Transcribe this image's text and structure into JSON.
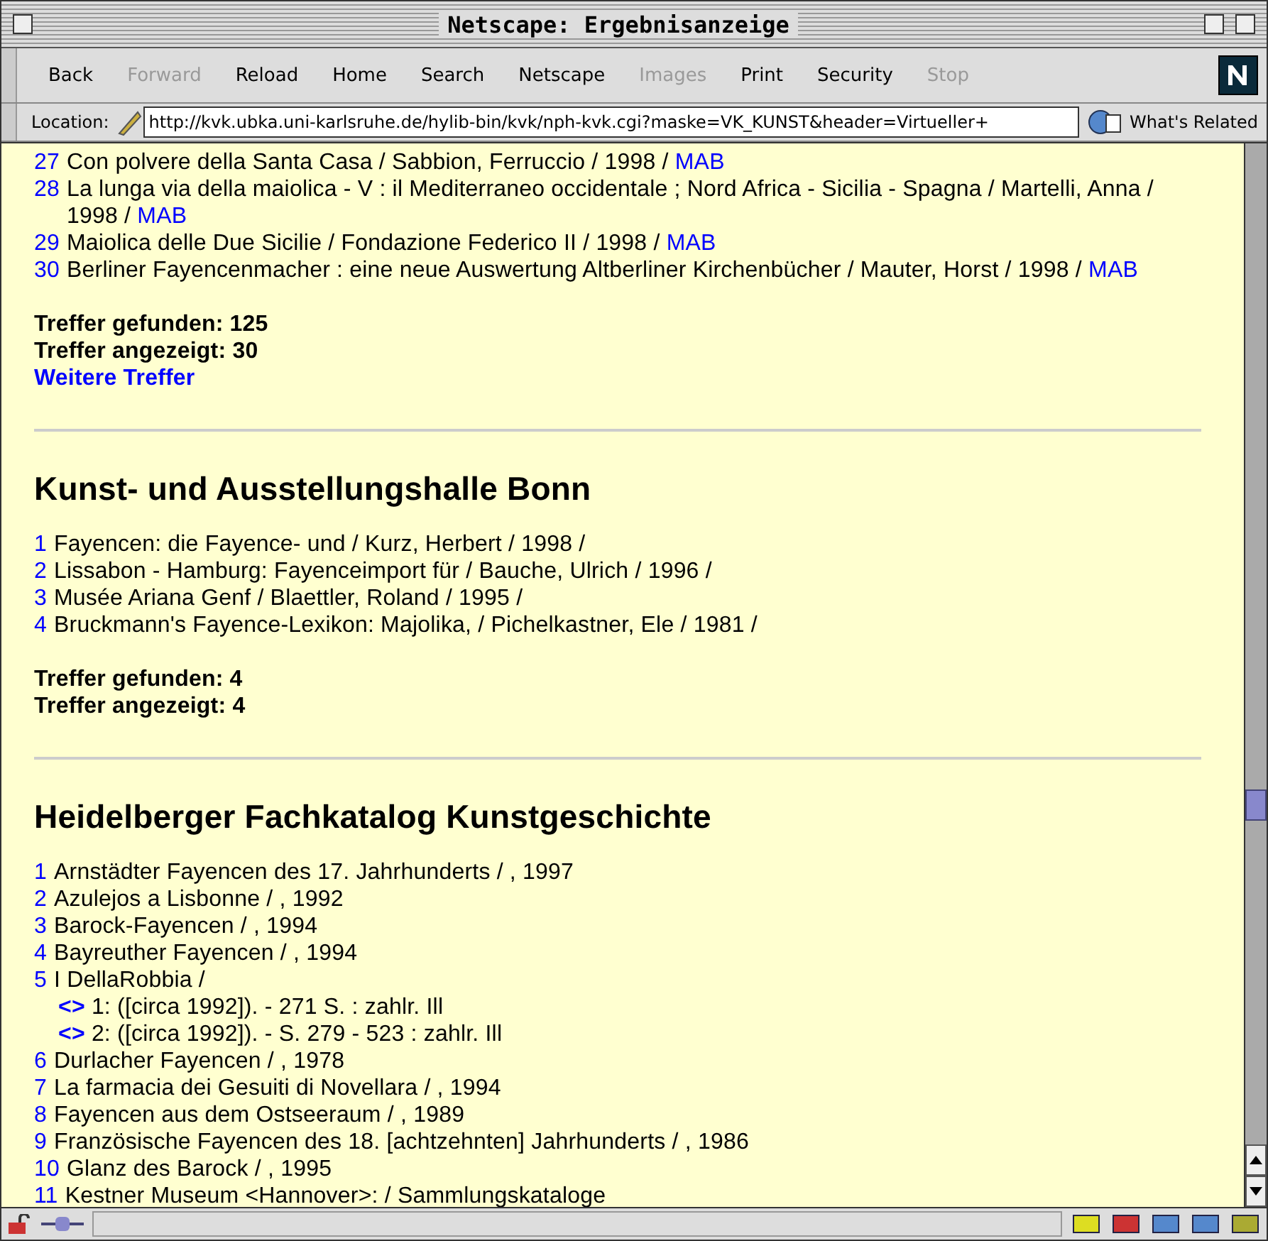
{
  "window": {
    "title": "Netscape: Ergebnisanzeige"
  },
  "toolbar": [
    {
      "label": "Back",
      "disabled": false
    },
    {
      "label": "Forward",
      "disabled": true
    },
    {
      "label": "Reload",
      "disabled": false
    },
    {
      "label": "Home",
      "disabled": false
    },
    {
      "label": "Search",
      "disabled": false
    },
    {
      "label": "Netscape",
      "disabled": false
    },
    {
      "label": "Images",
      "disabled": true
    },
    {
      "label": "Print",
      "disabled": false
    },
    {
      "label": "Security",
      "disabled": false
    },
    {
      "label": "Stop",
      "disabled": true
    }
  ],
  "location": {
    "label": "Location:",
    "value": "http://kvk.ubka.uni-karlsruhe.de/hylib-bin/kvk/nph-kvk.cgi?maske=VK_KUNST&header=Virtueller+",
    "related": "What's Related"
  },
  "sections": [
    {
      "entries": [
        {
          "number": "27",
          "text": "Con polvere della Santa Casa / Sabbion, Ferruccio / 1998 /",
          "link": "MAB"
        },
        {
          "number": "28",
          "text": "La lunga via della maiolica - V : il Mediterraneo occidentale ; Nord Africa - Sicilia - Spagna / Martelli, Anna / 1998 /",
          "link": "MAB"
        },
        {
          "number": "29",
          "text": "Maiolica delle Due Sicilie / Fondazione Federico II / 1998 /",
          "link": "MAB"
        },
        {
          "number": "30",
          "text": "Berliner Fayencenmacher : eine neue Auswertung Altberliner Kirchenbücher / Mauter, Horst / 1998 /",
          "link": "MAB"
        }
      ],
      "found": "Treffer gefunden: 125",
      "shown": "Treffer angezeigt: 30",
      "more": "Weitere Treffer"
    },
    {
      "heading": "Kunst- und Ausstellungshalle Bonn",
      "entries": [
        {
          "number": "1",
          "text": "Fayencen: die Fayence- und / Kurz, Herbert / 1998 /"
        },
        {
          "number": "2",
          "text": "Lissabon - Hamburg: Fayenceimport für / Bauche, Ulrich / 1996 /"
        },
        {
          "number": "3",
          "text": "Musée Ariana Genf / Blaettler, Roland / 1995 /"
        },
        {
          "number": "4",
          "text": "Bruckmann's Fayence-Lexikon: Majolika, / Pichelkastner, Ele / 1981 /"
        }
      ],
      "found": "Treffer gefunden: 4",
      "shown": "Treffer angezeigt: 4"
    },
    {
      "heading": "Heidelberger Fachkatalog Kunstgeschichte",
      "entries": [
        {
          "number": "1",
          "text": "Arnstädter Fayencen des 17. Jahrhunderts / , 1997"
        },
        {
          "number": "2",
          "text": "Azulejos a Lisbonne / , 1992"
        },
        {
          "number": "3",
          "text": "Barock-Fayencen / , 1994"
        },
        {
          "number": "4",
          "text": "Bayreuther Fayencen / , 1994"
        },
        {
          "number": "5",
          "text": "I DellaRobbia /",
          "children": [
            {
              "marker": "<>",
              "text": "1: ([circa 1992]). - 271 S. : zahlr. Ill"
            },
            {
              "marker": "<>",
              "text": "2: ([circa 1992]). - S. 279 - 523 : zahlr. Ill"
            }
          ]
        },
        {
          "number": "6",
          "text": "Durlacher Fayencen / , 1978"
        },
        {
          "number": "7",
          "text": "La farmacia dei Gesuiti di Novellara / , 1994"
        },
        {
          "number": "8",
          "text": "Fayencen aus dem Ostseeraum / , 1989"
        },
        {
          "number": "9",
          "text": "Französische Fayencen des 18. [achtzehnten] Jahrhunderts / , 1986"
        },
        {
          "number": "10",
          "text": "Glanz des Barock / , 1995"
        },
        {
          "number": "11",
          "text": "Kestner Museum <Hannover>: / Sammlungskataloge"
        }
      ]
    }
  ]
}
